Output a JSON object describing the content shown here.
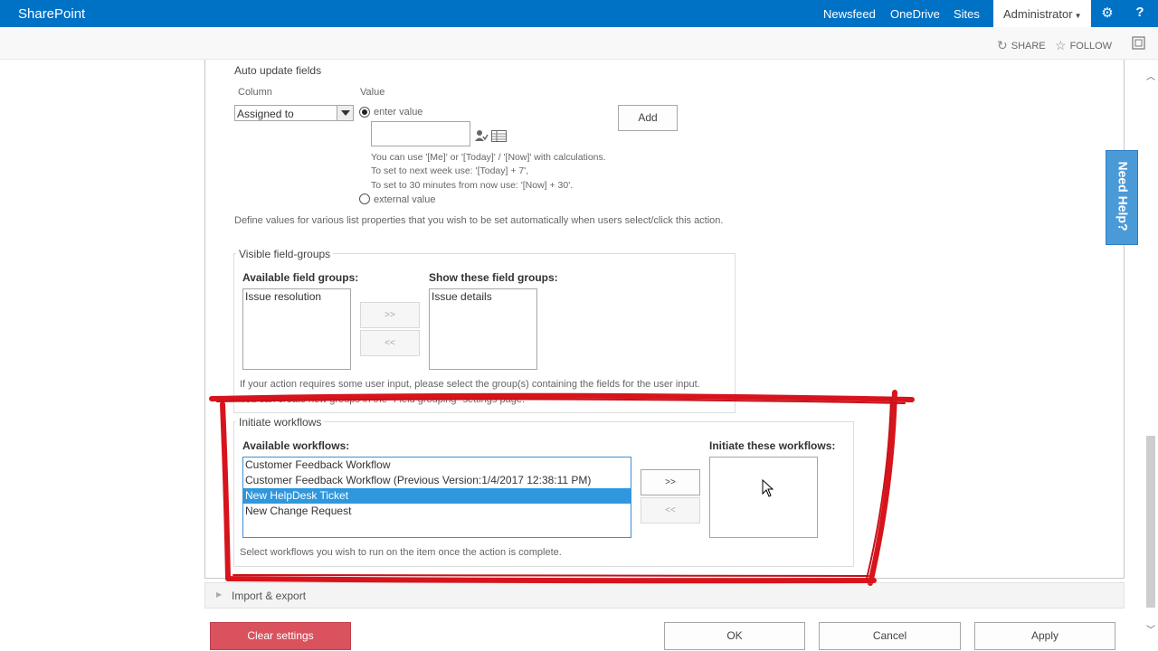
{
  "suitebar": {
    "brand": "SharePoint",
    "nav": [
      "Newsfeed",
      "OneDrive",
      "Sites"
    ],
    "user": "Administrator",
    "settings_icon": "gear-icon",
    "help_icon": "question-icon"
  },
  "subbar": {
    "share": "SHARE",
    "follow": "FOLLOW"
  },
  "auto_update": {
    "title": "Auto update fields",
    "column_header": "Column",
    "value_header": "Value",
    "column_value": "Assigned to",
    "enter_value_label": "enter value",
    "external_value_label": "external value",
    "add_button": "Add",
    "hints": [
      "You can use '[Me]' or '[Today]' / '[Now]' with calculations.",
      "To set to next week use: '[Today] + 7',",
      "To set to 30 minutes from now use: '[Now] + 30'."
    ],
    "description": "Define values for various list properties that you wish to be set automatically when users select/click this action."
  },
  "field_groups": {
    "legend": "Visible field-groups",
    "available_label": "Available field groups:",
    "show_label": "Show these field groups:",
    "available_items": [
      "Issue resolution"
    ],
    "show_items": [
      "Issue details"
    ],
    "add_btn": ">>",
    "remove_btn": "<<",
    "note_line1": "If your action requires some user input, please select the group(s) containing the fields for the user input.",
    "note_line2": "You can create new groups in the \"Field grouping\" settings page."
  },
  "workflows": {
    "legend": "Initiate workflows",
    "available_label": "Available workflows:",
    "initiate_label": "Initiate these workflows:",
    "available_items": [
      "Customer Feedback Workflow",
      "Customer Feedback Workflow (Previous Version:1/4/2017 12:38:11 PM)",
      "New HelpDesk Ticket",
      "New Change Request"
    ],
    "selected_index": 2,
    "add_btn": ">>",
    "remove_btn": "<<",
    "note": "Select workflows you wish to run on the item once the action is complete."
  },
  "import_export": {
    "label": "Import & export"
  },
  "footer": {
    "clear": "Clear settings",
    "ok": "OK",
    "cancel": "Cancel",
    "apply": "Apply"
  },
  "need_help": "Need Help?",
  "colors": {
    "suitebar": "#0072c6",
    "selection": "#2f97dd",
    "danger": "#d9525e",
    "annotation": "#d7141c"
  }
}
